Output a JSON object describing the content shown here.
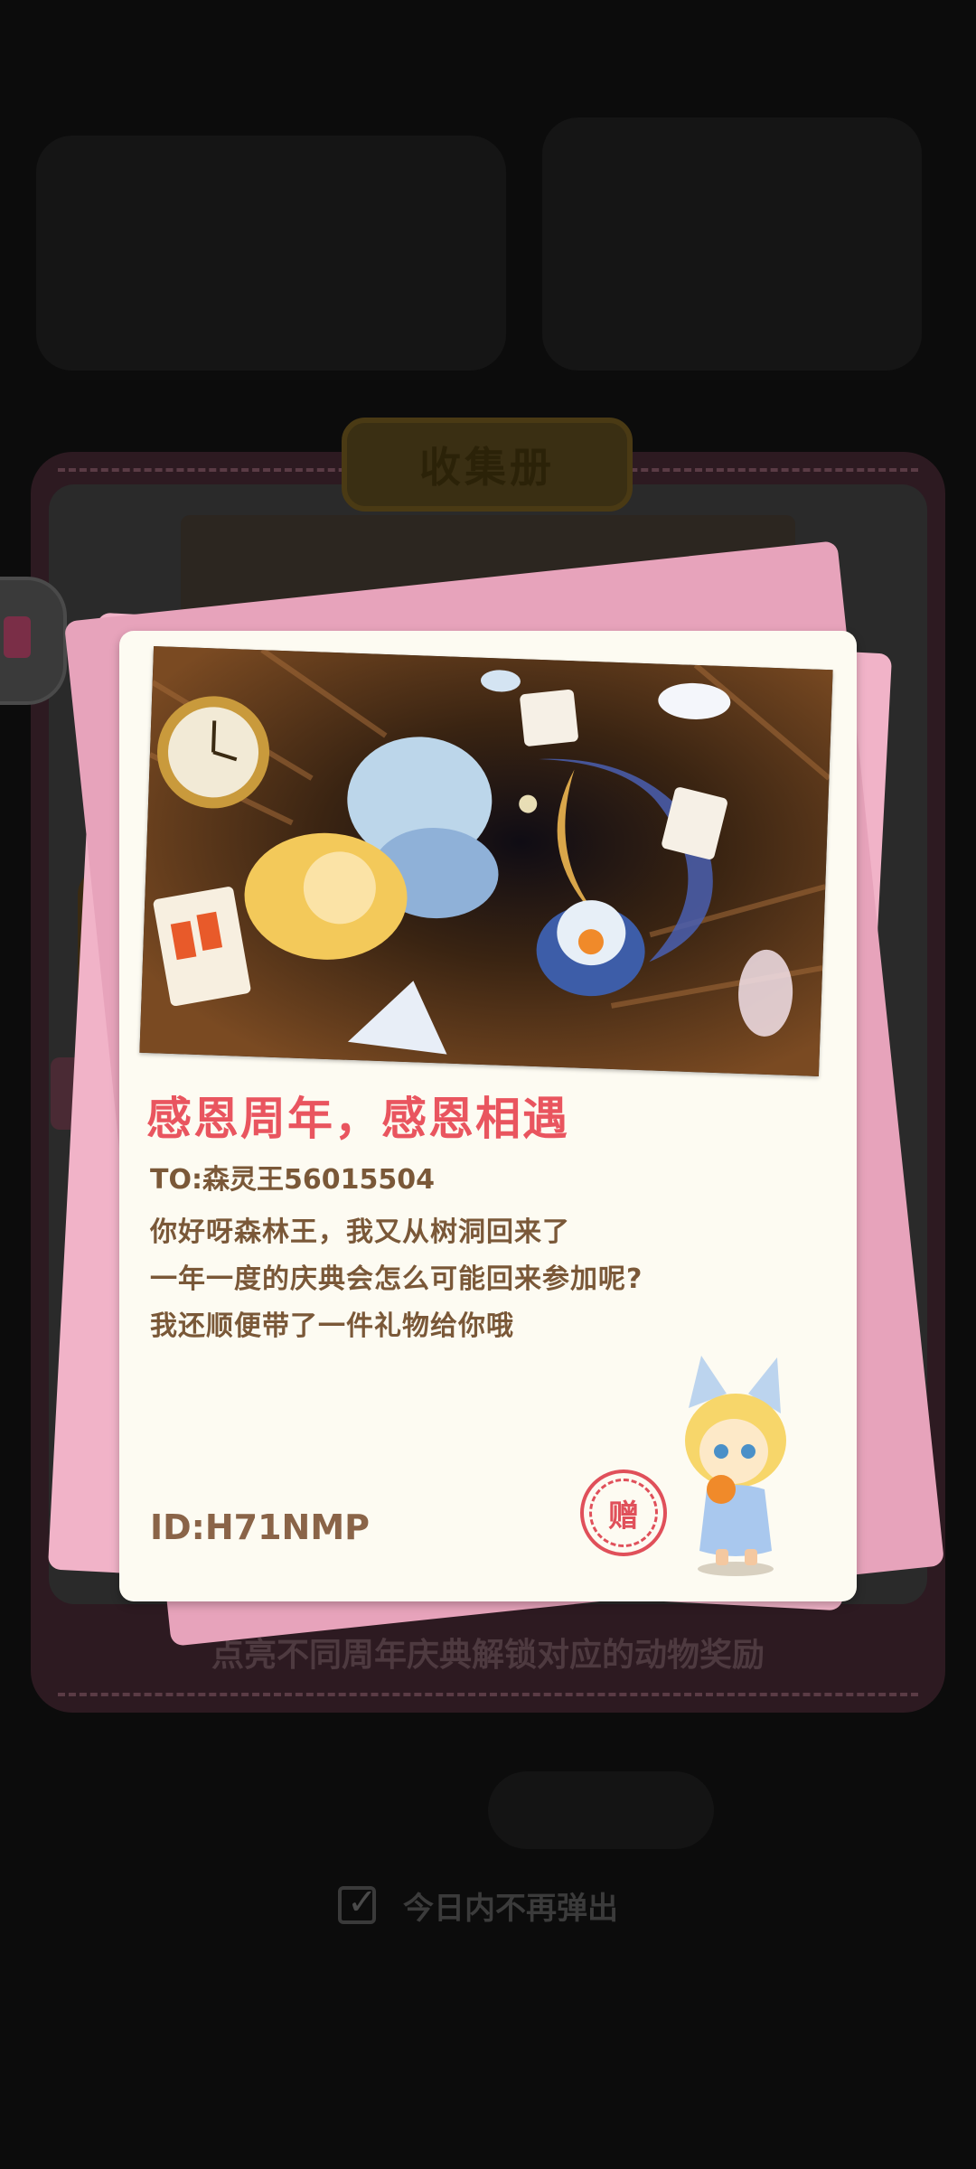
{
  "album": {
    "title": "收集册",
    "hint": "点亮不同周年庆典解锁对应的动物奖励"
  },
  "letter": {
    "title": "感恩周年，感恩相遇",
    "to": "TO:森灵王56015504",
    "lines": [
      "你好呀森林王，我又从树洞回来了",
      "一年一度的庆典会怎么可能回来参加呢?",
      "我还顺便带了一件礼物给你哦"
    ],
    "id": "ID:H71NMP",
    "stamp": "赠"
  },
  "footer": {
    "dont_show_today": "今日内不再弹出",
    "checked": true
  }
}
